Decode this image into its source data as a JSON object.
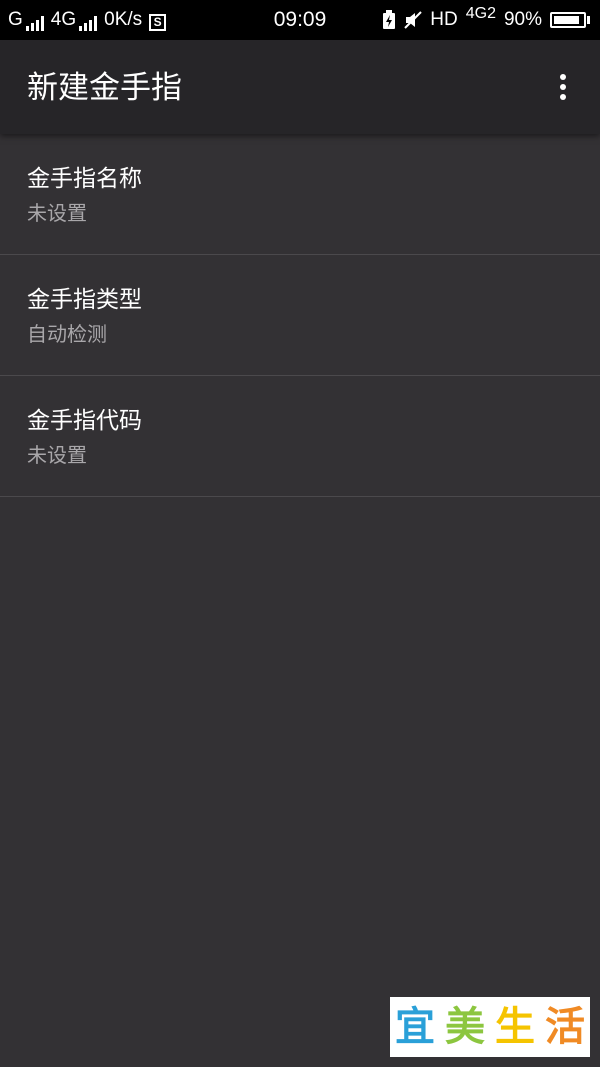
{
  "status_bar": {
    "carrier1": "G",
    "carrier2": "4G",
    "speed": "0K/s",
    "sim_label": "S",
    "time": "09:09",
    "hd": "HD",
    "net": "4G",
    "net_sub": "2",
    "battery": "90%",
    "battery_level": 0.9
  },
  "app_bar": {
    "title": "新建金手指",
    "menu_icon": "overflow-menu-icon"
  },
  "list": {
    "items": [
      {
        "title": "金手指名称",
        "summary": "未设置"
      },
      {
        "title": "金手指类型",
        "summary": "自动检测"
      },
      {
        "title": "金手指代码",
        "summary": "未设置"
      }
    ]
  },
  "watermark": {
    "chars": [
      "宜",
      "美",
      "生",
      "活"
    ],
    "colors": [
      "#2aa0d8",
      "#8cc63f",
      "#f5c400",
      "#f08a24"
    ]
  },
  "colors": {
    "background": "#333134",
    "app_bar": "#262528",
    "status_bar": "#000000",
    "divider": "#4b494c"
  }
}
